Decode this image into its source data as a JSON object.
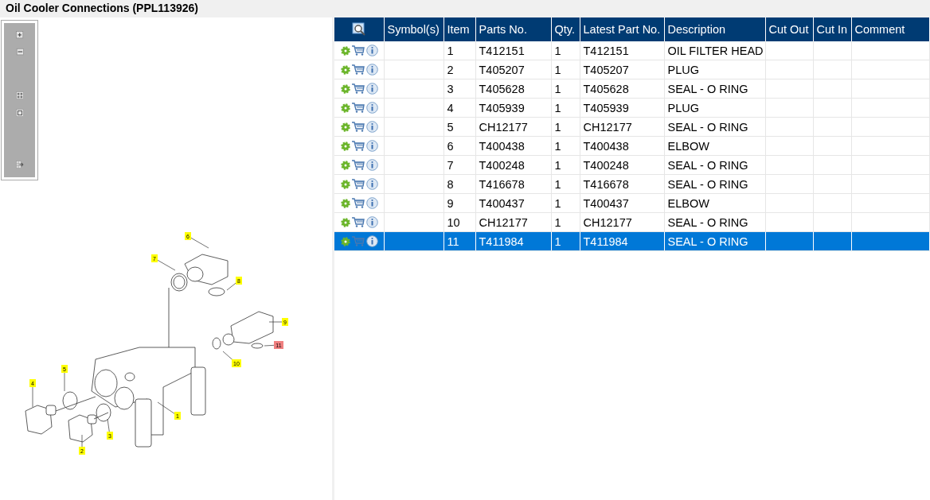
{
  "title": "Oil Cooler Connections (PPL113926)",
  "toolbar": {
    "buttons": [
      {
        "kind": "zoom-in"
      },
      {
        "kind": "zoom-out"
      },
      {
        "kind": "fit"
      },
      {
        "kind": "actual"
      },
      {
        "kind": "export"
      }
    ]
  },
  "diagram": {
    "callouts": [
      {
        "label": "1",
        "selected": false
      },
      {
        "label": "2",
        "selected": false
      },
      {
        "label": "3",
        "selected": false
      },
      {
        "label": "4",
        "selected": false
      },
      {
        "label": "5",
        "selected": false
      },
      {
        "label": "6",
        "selected": false
      },
      {
        "label": "7",
        "selected": false
      },
      {
        "label": "8",
        "selected": false
      },
      {
        "label": "9",
        "selected": false
      },
      {
        "label": "10",
        "selected": false
      },
      {
        "label": "11",
        "selected": true
      }
    ]
  },
  "table": {
    "columns": [
      "Symbol(s)",
      "Item",
      "Parts No.",
      "Qty.",
      "Latest Part No.",
      "Description",
      "Cut Out",
      "Cut In",
      "Comment"
    ],
    "rows": [
      {
        "item": "1",
        "parts_no": "T412151",
        "qty": "1",
        "latest_part_no": "T412151",
        "description": "OIL FILTER HEAD",
        "selected": false
      },
      {
        "item": "2",
        "parts_no": "T405207",
        "qty": "1",
        "latest_part_no": "T405207",
        "description": "PLUG",
        "selected": false
      },
      {
        "item": "3",
        "parts_no": "T405628",
        "qty": "1",
        "latest_part_no": "T405628",
        "description": "SEAL - O RING",
        "selected": false
      },
      {
        "item": "4",
        "parts_no": "T405939",
        "qty": "1",
        "latest_part_no": "T405939",
        "description": "PLUG",
        "selected": false
      },
      {
        "item": "5",
        "parts_no": "CH12177",
        "qty": "1",
        "latest_part_no": "CH12177",
        "description": "SEAL - O RING",
        "selected": false
      },
      {
        "item": "6",
        "parts_no": "T400438",
        "qty": "1",
        "latest_part_no": "T400438",
        "description": "ELBOW",
        "selected": false
      },
      {
        "item": "7",
        "parts_no": "T400248",
        "qty": "1",
        "latest_part_no": "T400248",
        "description": "SEAL - O RING",
        "selected": false
      },
      {
        "item": "8",
        "parts_no": "T416678",
        "qty": "1",
        "latest_part_no": "T416678",
        "description": "SEAL - O RING",
        "selected": false
      },
      {
        "item": "9",
        "parts_no": "T400437",
        "qty": "1",
        "latest_part_no": "T400437",
        "description": "ELBOW",
        "selected": false
      },
      {
        "item": "10",
        "parts_no": "CH12177",
        "qty": "1",
        "latest_part_no": "CH12177",
        "description": "SEAL - O RING",
        "selected": false
      },
      {
        "item": "11",
        "parts_no": "T411984",
        "qty": "1",
        "latest_part_no": "T411984",
        "description": "SEAL - O RING",
        "selected": true
      }
    ]
  }
}
